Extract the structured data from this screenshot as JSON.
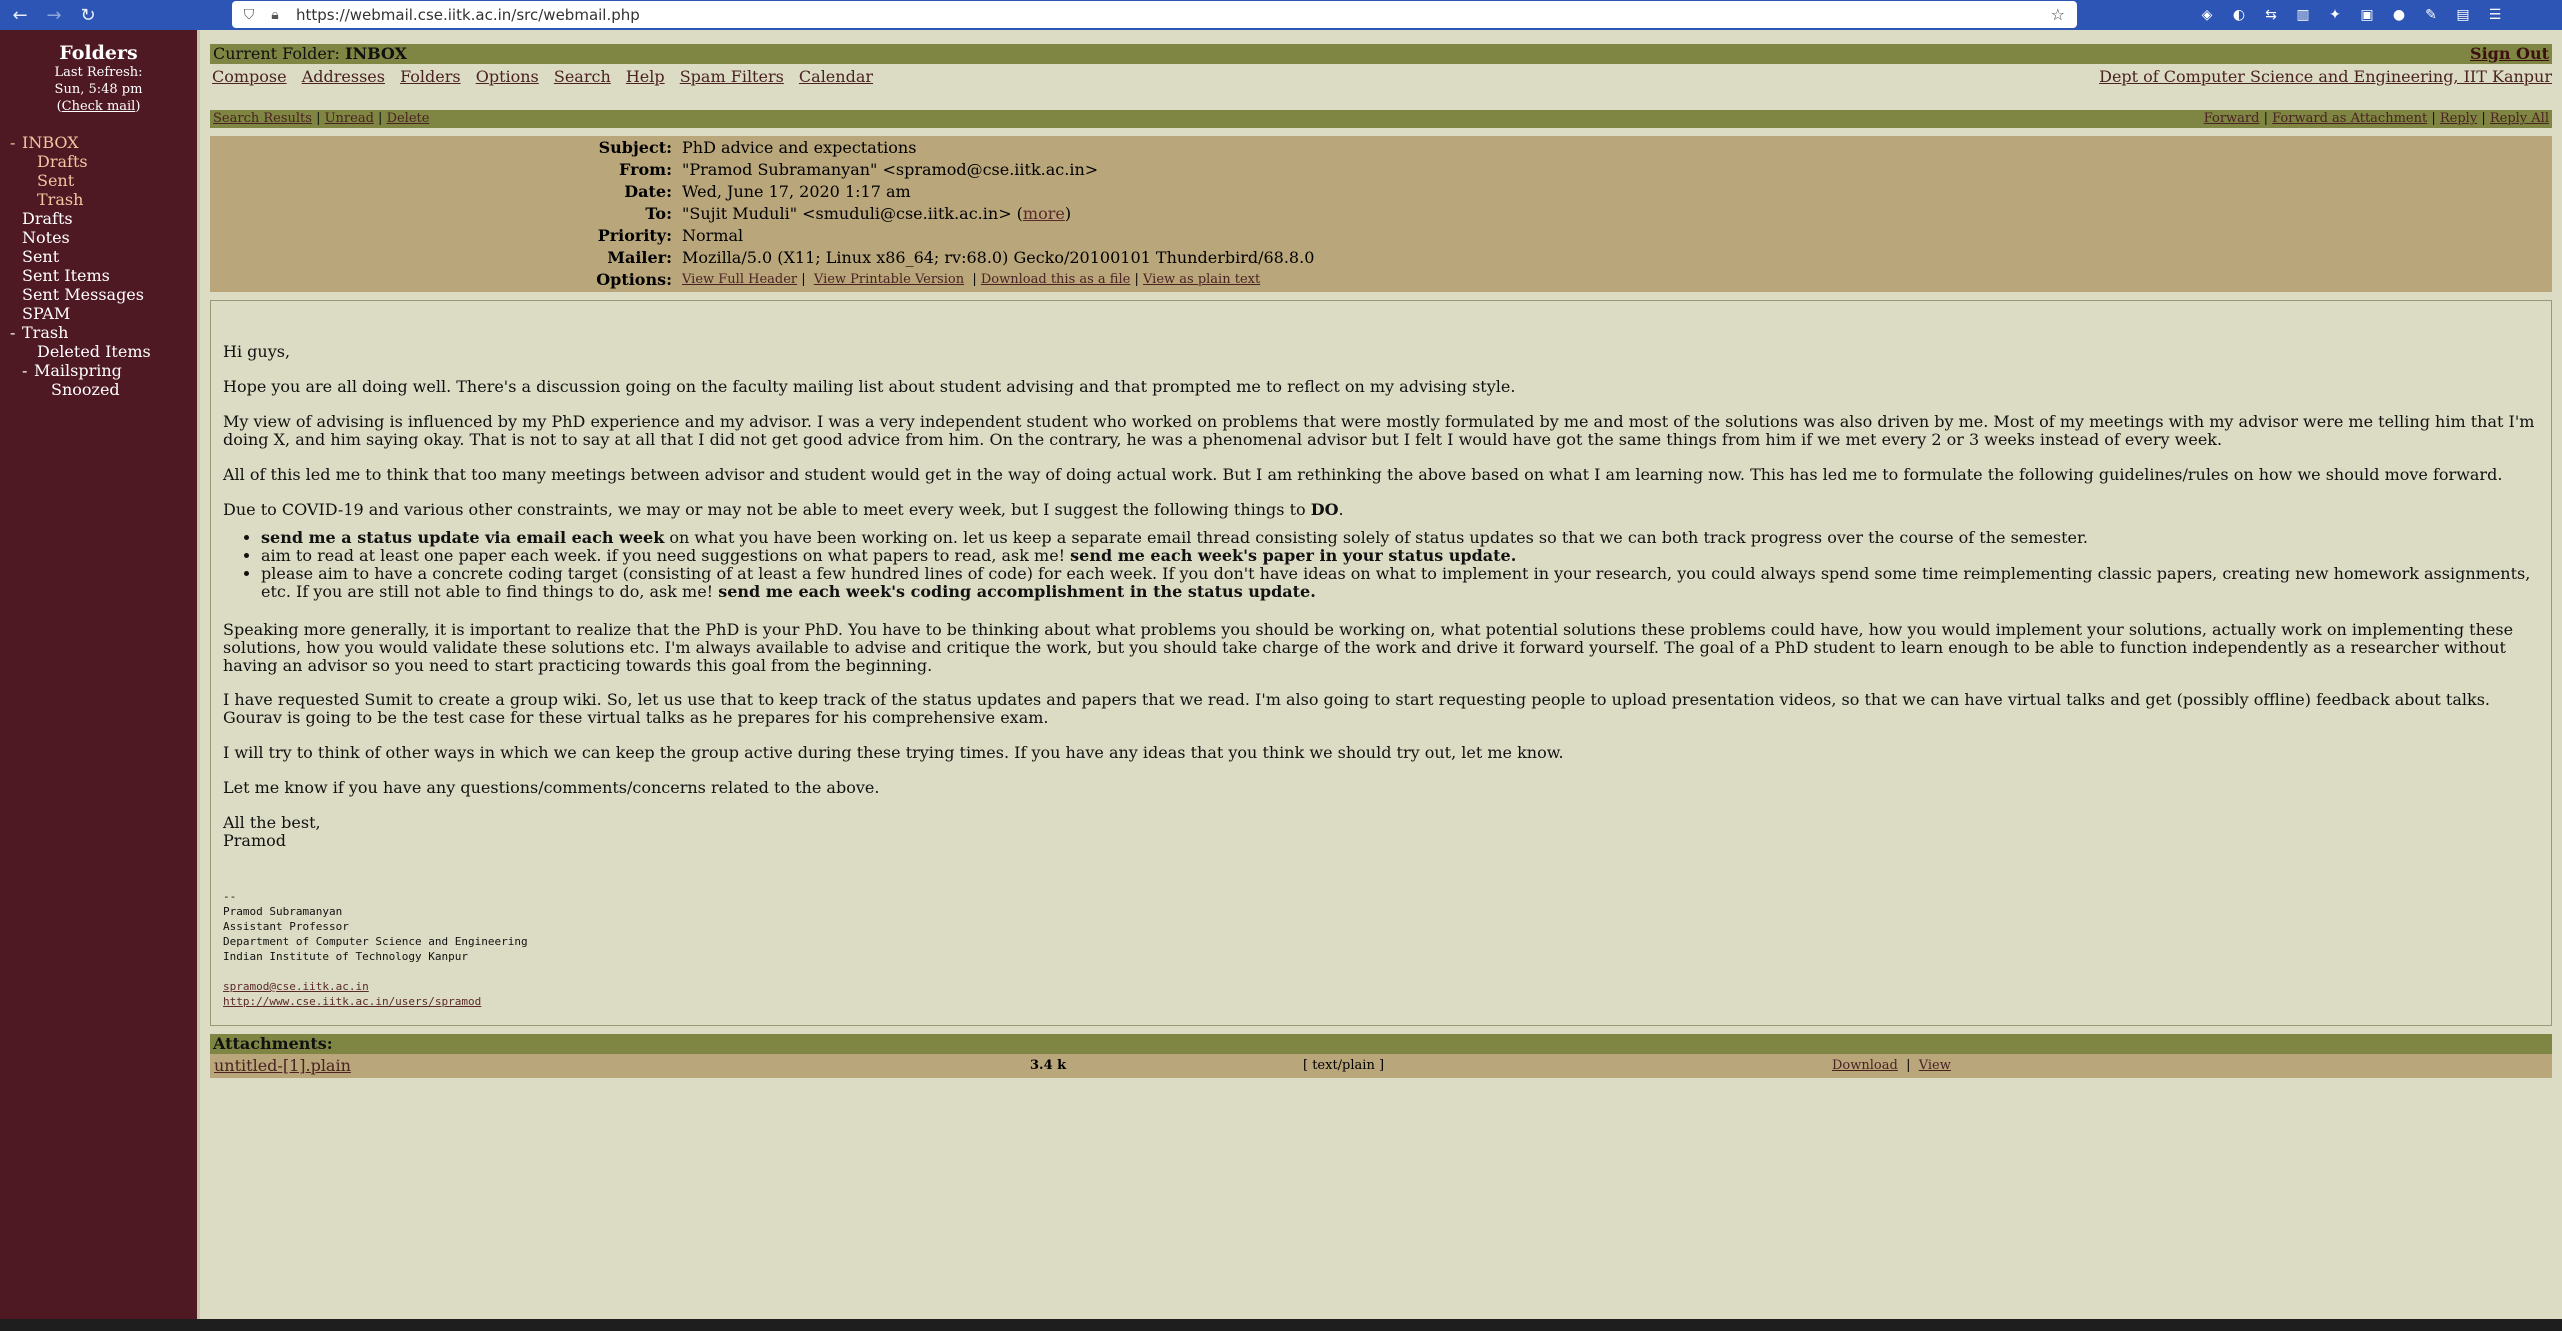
{
  "browser": {
    "url": "https://webmail.cse.iitk.ac.in/src/webmail.php",
    "icons": [
      "back-icon",
      "forward-icon",
      "reload-icon",
      "shield-icon",
      "lock-icon",
      "star-icon",
      "pocket-icon",
      "account-icon",
      "extension-icon",
      "library-icon",
      "fox-icon",
      "zoom-icon",
      "grammarly-icon",
      "feather-icon",
      "container-icon",
      "menu-icon"
    ]
  },
  "left": {
    "title": "Folders",
    "last_refresh_label": "Last Refresh:",
    "last_refresh_time": "Sun, 5:48 pm",
    "check_mail": "Check mail",
    "folders": [
      {
        "label": "INBOX",
        "toggle": "-"
      },
      {
        "label": "Drafts"
      },
      {
        "label": "Sent"
      },
      {
        "label": "Trash"
      },
      {
        "label": "Drafts"
      },
      {
        "label": "Notes"
      },
      {
        "label": "Sent"
      },
      {
        "label": "Sent Items"
      },
      {
        "label": "Sent Messages"
      },
      {
        "label": "SPAM"
      },
      {
        "label": "Trash",
        "toggle": "-"
      },
      {
        "label": "Deleted Items"
      },
      {
        "label": "Mailspring",
        "toggle": "-"
      },
      {
        "label": "Snoozed"
      }
    ]
  },
  "top": {
    "current_folder_label": "Current Folder:",
    "current_folder": "INBOX",
    "sign_out": "Sign Out",
    "menu": [
      "Compose",
      "Addresses",
      "Folders",
      "Options",
      "Search",
      "Help",
      "Spam Filters",
      "Calendar"
    ],
    "dept": "Dept of Computer Science and Engineering, IIT Kanpur"
  },
  "actions": {
    "left": [
      "Search Results",
      "Unread",
      "Delete"
    ],
    "right": [
      "Forward",
      "Forward as Attachment",
      "Reply",
      "Reply All"
    ]
  },
  "header": {
    "subject_label": "Subject:",
    "subject": "PhD advice and expectations",
    "from_label": "From:",
    "from": "\"Pramod Subramanyan\" <spramod@cse.iitk.ac.in>",
    "date_label": "Date:",
    "date": "Wed, June 17, 2020 1:17 am",
    "to_label": "To:",
    "to": "\"Sujit Muduli\" <smuduli@cse.iitk.ac.in>",
    "more": "more",
    "priority_label": "Priority:",
    "priority": "Normal",
    "mailer_label": "Mailer:",
    "mailer": "Mozilla/5.0 (X11; Linux x86_64; rv:68.0) Gecko/20100101 Thunderbird/68.8.0",
    "options_label": "Options:",
    "options": [
      "View Full Header",
      "View Printable Version",
      "Download this as a file",
      "View as plain text"
    ]
  },
  "body": {
    "greeting": "Hi guys,",
    "p1": "Hope you are all doing well. There's a discussion going on the faculty mailing list about student advising and that prompted me to reflect on my advising style.",
    "p2": "My view of advising is influenced by my PhD experience and my advisor. I was a very independent student who worked on problems that were mostly formulated by me and most of the solutions was also driven by me. Most of my meetings with my advisor were me telling him that I'm doing X, and him saying okay. That is not to say at all that I did not get good advice from him. On the contrary, he was a phenomenal advisor but I felt I would have got the same things from him if we met every 2 or 3 weeks instead of every week.",
    "p3": "All of this led me to think that too many meetings between advisor and student would get in the way of doing actual work. But I am rethinking the above based on what I am learning now. This has led me to formulate the following guidelines/rules on how we should move forward.",
    "p4_pre": "Due to COVID-19 and various other constraints, we may or may not be able to meet every week, but I suggest the following things to ",
    "p4_bold": "DO",
    "p4_post": ".",
    "b1_bold": "send me a status update via email each week",
    "b1_rest": " on what you have been working on. let us keep a separate email thread consisting solely of status updates so that we can both track progress over the course of the semester.",
    "b2_pre": "aim to read at least one paper each week. if you need suggestions on what papers to read, ask me! ",
    "b2_bold": "send me each week's paper in your status update.",
    "b3_pre": "please aim to have a concrete coding target (consisting of at least a few hundred lines of code) for each week. If you don't have ideas on what to implement in your research, you could always spend some time reimplementing classic papers, creating new homework assignments, etc. If you are still not able to find things to do, ask me! ",
    "b3_bold": "send me each week's coding accomplishment in the status update.",
    "p5": "Speaking more generally, it is important to realize that the PhD is your PhD. You have to be thinking about what problems you should be working on, what potential solutions these problems could have, how you would implement your solutions, actually work on implementing these solutions, how you would validate these solutions etc. I'm always available to advise and critique the work, but you should take charge of the work and drive it forward yourself. The goal of a PhD student to learn enough to be able to function independently as a researcher without having an advisor so you need to start practicing towards this goal from the beginning.",
    "p6": "I have requested Sumit to create a group wiki. So, let us use that to keep track of the status updates and papers that we read. I'm also going to start requesting people to upload presentation videos, so that we can have virtual talks and get (possibly offline) feedback about talks. Gourav is going to be the test case for these virtual talks as he prepares for his comprehensive exam.",
    "p7": "I will try to think of other ways in which we can keep the group active during these trying times. If you have any ideas that you think we should try out, let me know.",
    "p8": "Let me know if you have any questions/comments/concerns related to the above.",
    "closing": "All the best,",
    "name": "Pramod",
    "sig_dash": "--",
    "sig_name": "Pramod Subramanyan",
    "sig_title": "Assistant Professor",
    "sig_dept": "Department of Computer Science and Engineering",
    "sig_inst": "Indian Institute of Technology Kanpur",
    "sig_email": "spramod@cse.iitk.ac.in",
    "sig_url": "http://www.cse.iitk.ac.in/users/spramod"
  },
  "attachments": {
    "label": "Attachments:",
    "items": [
      {
        "name": "untitled-[1].plain",
        "size": "3.4 k",
        "type": "[ text/plain ]",
        "download": "Download",
        "view": "View"
      }
    ]
  },
  "colors": {
    "sidebar": "#4e1923",
    "olive": "#7f8643",
    "header_bg": "#b9a67b",
    "body_bg": "#dcdcc4",
    "chrome": "#2d55b5"
  }
}
